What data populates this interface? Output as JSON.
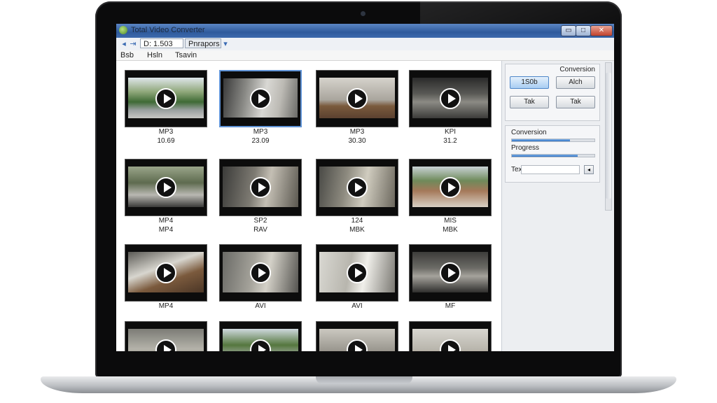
{
  "window": {
    "title": "Total Video Converter"
  },
  "window_controls": {
    "minimize": "▭",
    "restore": "□",
    "close": "✕"
  },
  "toolbar": {
    "field1": "D: 1.503",
    "field2": "Pnrapors"
  },
  "menu": [
    "Bsb",
    "Hsln",
    "Tsavin"
  ],
  "files": [
    {
      "format": "MP3",
      "detail": "10.69"
    },
    {
      "format": "MP3",
      "detail": "23.09"
    },
    {
      "format": "MP3",
      "detail": "30.30"
    },
    {
      "format": "KPI",
      "detail": "31.2"
    },
    {
      "format": "MP4",
      "detail": "MP4"
    },
    {
      "format": "SP2",
      "detail": "RAV"
    },
    {
      "format": "124",
      "detail": "MBK"
    },
    {
      "format": "MIS",
      "detail": "MBK"
    },
    {
      "format": "MP4",
      "detail": ""
    },
    {
      "format": "AVI",
      "detail": ""
    },
    {
      "format": "AVI",
      "detail": ""
    },
    {
      "format": "MF",
      "detail": ""
    },
    {
      "format": "",
      "detail": ""
    },
    {
      "format": "",
      "detail": ""
    },
    {
      "format": "",
      "detail": ""
    },
    {
      "format": "",
      "detail": ""
    }
  ],
  "side": {
    "conversion_title": "Conversion",
    "buttons": [
      "1S0b",
      "Alch",
      "Tak",
      "Tak"
    ],
    "conversion_label": "Conversion",
    "progress_label": "Progress",
    "conversion_progress": 0.7,
    "progress_progress": 0.8,
    "path_label": "Tex",
    "browse": "◂"
  }
}
